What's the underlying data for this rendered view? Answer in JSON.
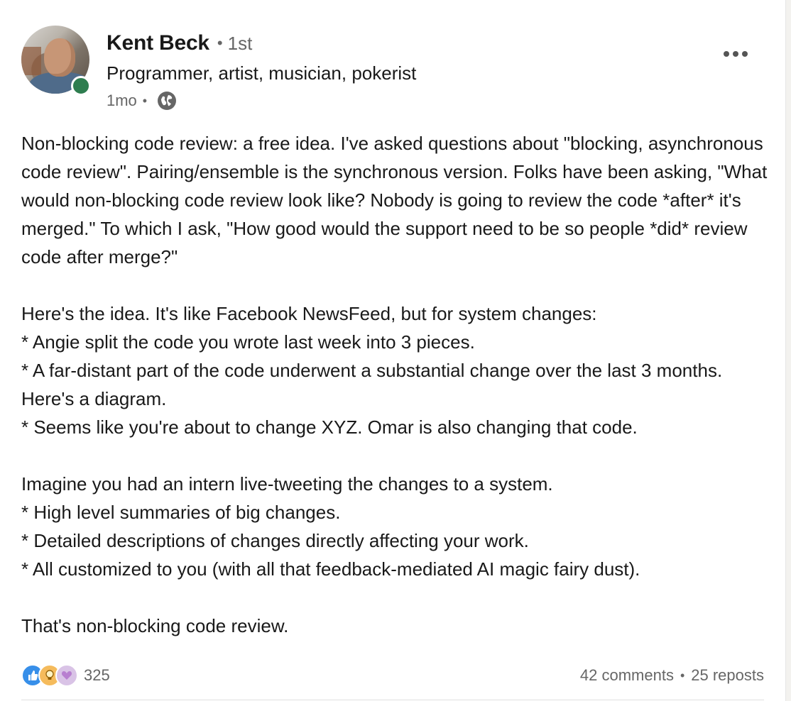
{
  "author": {
    "name": "Kent Beck",
    "connection_degree": "1st",
    "headline": "Programmer, artist, musician, pokerist",
    "posted_ago": "1mo",
    "online": true
  },
  "post": {
    "paragraphs": [
      "Non-blocking code review: a free idea. I've asked questions about \"blocking, asynchronous code review\". Pairing/ensemble is the synchronous version. Folks have been asking, \"What would non-blocking code review look like? Nobody is going to review the code *after* it's merged.\" To which I ask, \"How good would the support need to be so people *did* review code after merge?\"",
      "Here's the idea. It's like Facebook NewsFeed, but for system changes:\n* Angie split the code you wrote last week into 3 pieces.\n* A far-distant part of the code underwent a substantial change over the last 3 months. Here's a diagram.\n* Seems like you're about to change XYZ. Omar is also changing that code.",
      "Imagine you had an intern live-tweeting the changes to a system.\n* High level summaries of big changes.\n* Detailed descriptions of changes directly affecting your work.\n* All customized to you (with all that feedback-mediated AI magic fairy dust).",
      "That's non-blocking code review."
    ]
  },
  "social": {
    "reaction_count": "325",
    "reaction_icons": [
      "like-icon",
      "insightful-icon",
      "support-icon"
    ],
    "comments": "42 comments",
    "reposts": "25 reposts"
  },
  "colors": {
    "online": "#2e7d4f",
    "like": "#378fe9",
    "insightful": "#f5bb5c",
    "support": "#d9c3e6"
  }
}
